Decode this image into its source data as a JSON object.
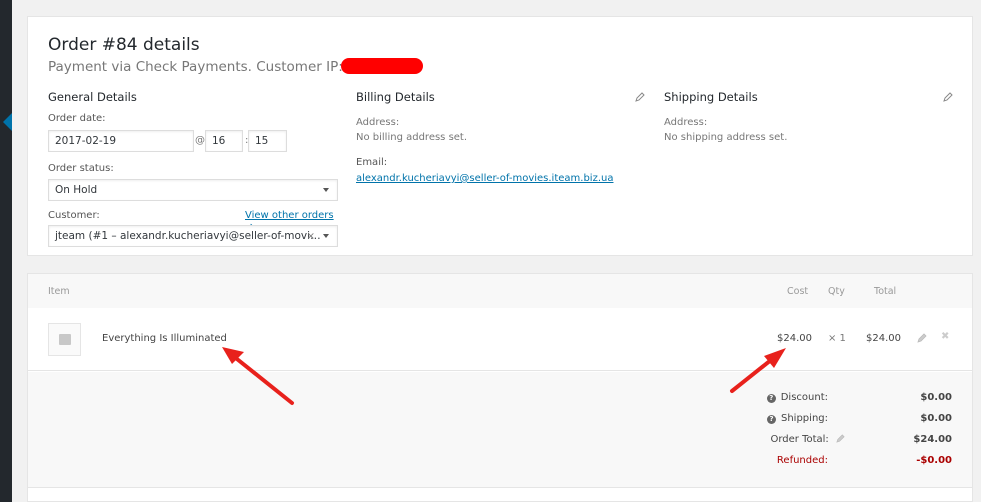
{
  "order": {
    "title": "Order #84 details",
    "subtitle": "Payment via Check Payments. Customer IP:"
  },
  "general": {
    "heading": "General Details",
    "order_date_label": "Order date:",
    "date": "2017-02-19",
    "at": "@",
    "hour": "16",
    "colon": ":",
    "minute": "15",
    "status_label": "Order status:",
    "status": "On Hold",
    "customer_label": "Customer:",
    "view_orders": "View other orders →",
    "customer": "jteam (#1 – alexandr.kucheriavyi@seller-of-movi…",
    "clear": "×"
  },
  "billing": {
    "heading": "Billing Details",
    "address_label": "Address:",
    "address_value": "No billing address set.",
    "email_label": "Email:",
    "email": "alexandr.kucheriavyi@seller-of-movies.iteam.biz.ua"
  },
  "shipping": {
    "heading": "Shipping Details",
    "address_label": "Address:",
    "address_value": "No shipping address set."
  },
  "items": {
    "columns": {
      "item": "Item",
      "cost": "Cost",
      "qty": "Qty",
      "total": "Total"
    },
    "rows": [
      {
        "name": "Everything Is Illuminated",
        "cost": "$24.00",
        "qty": "× 1",
        "total": "$24.00"
      }
    ]
  },
  "totals": {
    "discount_label": "Discount:",
    "discount": "$0.00",
    "shipping_label": "Shipping:",
    "shipping": "$0.00",
    "order_total_label": "Order Total:",
    "order_total": "$24.00",
    "refunded_label": "Refunded:",
    "refunded": "-$0.00"
  },
  "icons": {
    "help": "?",
    "delete": "✖"
  },
  "colors": {
    "accent": "#0073aa",
    "annotation": "#e8211c",
    "refunded": "#aa0000"
  }
}
